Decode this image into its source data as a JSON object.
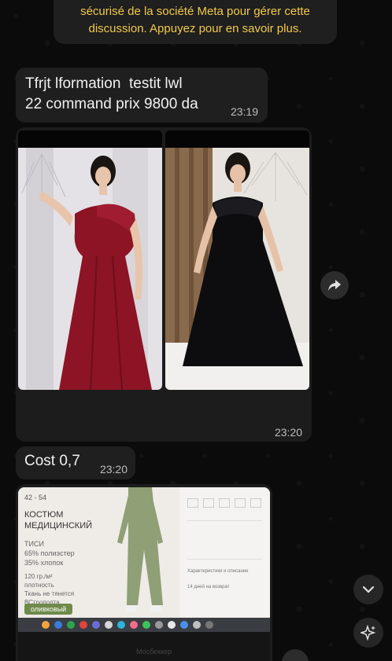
{
  "system_notice": {
    "line1": "sécurisé de la société Meta pour gérer cette",
    "line2": "discussion. Appuyez pour en savoir plus."
  },
  "messages": [
    {
      "text_line1": "Tfrjt lformation  testit lwl",
      "text_line2": "22 command prix 9800 da",
      "time": "23:19"
    },
    {
      "album_time": "23:20"
    },
    {
      "text": "Cost 0,7",
      "time": "23:20"
    }
  ],
  "screenshot_card": {
    "sizes": "42 - 54",
    "title_line1": "КОСТЮМ",
    "title_line2": "МЕДИЦИНСКИЙ",
    "fabric_line1": "ТИСИ",
    "fabric_line2": "65% полиэстер",
    "fabric_line3": "35% хлопок",
    "weight_line1": "120 гр./м²",
    "weight_line2": "плотность",
    "weight_line3": "Ткань не тянется",
    "weight_line4": "ВСтрополта",
    "color_chip": "оливковый",
    "table_label": "Характеристики и описание",
    "return_label": "14 дней на возврат",
    "monitor_brand": "Мосбеккер"
  },
  "icons": {
    "share": "share-arrow-icon",
    "scroll_down": "chevron-down-icon",
    "ai": "sparkle-icon"
  },
  "colors": {
    "notice_text": "#f2c94c",
    "bubble": "#1f1f1f",
    "background": "#0b0b0b"
  }
}
